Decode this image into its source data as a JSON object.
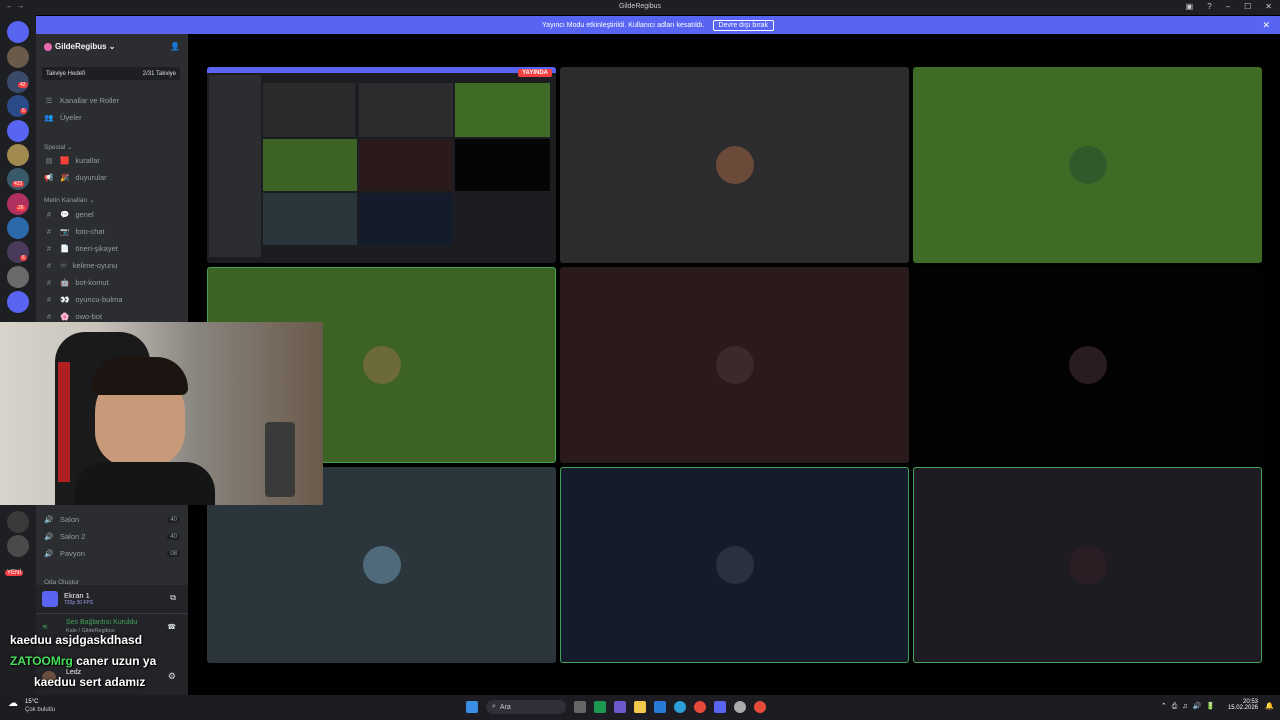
{
  "window": {
    "title": "GildeRegibus",
    "back": "←",
    "forward": "→"
  },
  "banner": {
    "text": "Yayıncı Modu etkinleştirildi. Kullanıcı adları kesatıldı.",
    "button": "Devre dışı bırak"
  },
  "server": {
    "name": "GildeRegibus",
    "boost_label": "Takviye Hedefi",
    "boost_count": "2/31 Takviye",
    "top_items": [
      "Kanallar ve Roller",
      "Üyeler"
    ],
    "categories": [
      "Special",
      "Metin Kanalları"
    ],
    "special_channels": [
      {
        "name": "kurallar",
        "emoji": "🟥"
      },
      {
        "name": "duyurular",
        "emoji": "🎉"
      }
    ],
    "text_channels": [
      {
        "name": "genel",
        "emoji": "💬"
      },
      {
        "name": "foto-chat",
        "emoji": "📷"
      },
      {
        "name": "öneri-şikayet",
        "emoji": "📄"
      },
      {
        "name": "kelime-oyunu",
        "emoji": "♾"
      },
      {
        "name": "bot-komut",
        "emoji": "🤖"
      },
      {
        "name": "oyuncu-bulma",
        "emoji": "👀"
      },
      {
        "name": "owo-bot",
        "emoji": "🌸"
      }
    ],
    "voice_channels": [
      {
        "name": "Salon",
        "count": "40"
      },
      {
        "name": "Salon 2",
        "count": "40"
      },
      {
        "name": "Pavyon",
        "count": "08"
      }
    ],
    "create_room": "Oda Oluştur"
  },
  "servers_badges": [
    "42",
    "6",
    "423",
    "26",
    "6",
    "YENİ"
  ],
  "stream": {
    "live_badge": "YAYINDA",
    "screen_name": "Ekran 1",
    "screen_meta": "720p 30 FPS"
  },
  "voice_status": {
    "status": "Ses Bağlantısı Kuruldu",
    "location": "Kale / GildeRegibus"
  },
  "user": {
    "name": "Ledz"
  },
  "chat_overlay": [
    {
      "user": "kaeduu",
      "msg": "asjdgaskdhasd"
    },
    {
      "user": "ZATOOMrg",
      "msg": "caner uzun ya"
    },
    {
      "user": "kaeduu",
      "msg": "sert adamız"
    }
  ],
  "tiles": [
    {
      "bg": "#2c2b2e",
      "avatar": "#6b4a3a",
      "active": false
    },
    {
      "bg": "#3e6b26",
      "avatar": "#2f5a2a",
      "active": false
    },
    {
      "bg": "#3c6324",
      "avatar": "#6d6a3a",
      "active": true
    },
    {
      "bg": "#2a1a1c",
      "avatar": "#3a2a2a",
      "active": false
    },
    {
      "bg": "#020202",
      "avatar": "#2a1a22",
      "active": false
    },
    {
      "bg": "#2a363c",
      "avatar": "#4f6a7a",
      "active": false
    },
    {
      "bg": "#141c2c",
      "avatar": "#2a3040",
      "active": true
    },
    {
      "bg": "#1e1c22",
      "avatar": "#2a1e24",
      "active": true
    }
  ],
  "taskbar": {
    "weather_temp": "15°C",
    "weather_desc": "Çok bulutlu",
    "search": "Ara",
    "time": "20:53",
    "date": "15.02.2026"
  },
  "colors": {
    "accent": "#5865f2",
    "speaking": "#43a25a"
  }
}
